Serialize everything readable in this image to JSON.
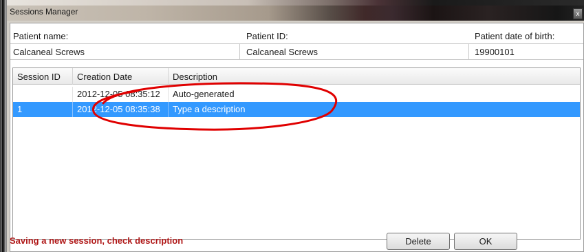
{
  "window": {
    "title": "Sessions Manager",
    "close_glyph": "x"
  },
  "patient": {
    "name_label": "Patient name:",
    "name_value": "Calcaneal Screws",
    "id_label": "Patient ID:",
    "id_value": "Calcaneal Screws",
    "dob_label": "Patient date of birth:",
    "dob_value": "19900101"
  },
  "table": {
    "columns": [
      "Session ID",
      "Creation Date",
      "Description"
    ],
    "rows": [
      {
        "session_id": "",
        "creation_date": "2012-12-05 08:35:12",
        "description": "Auto-generated",
        "selected": false
      },
      {
        "session_id": "1",
        "creation_date": "2012-12-05 08:35:38",
        "description": "Type a description",
        "selected": true
      }
    ]
  },
  "status": {
    "message": "Saving a new session, check description"
  },
  "buttons": {
    "delete_label": "Delete",
    "ok_label": "OK"
  },
  "colors": {
    "selection": "#3399ff",
    "status_text": "#b01818",
    "annotation_ellipse": "#e00000"
  }
}
